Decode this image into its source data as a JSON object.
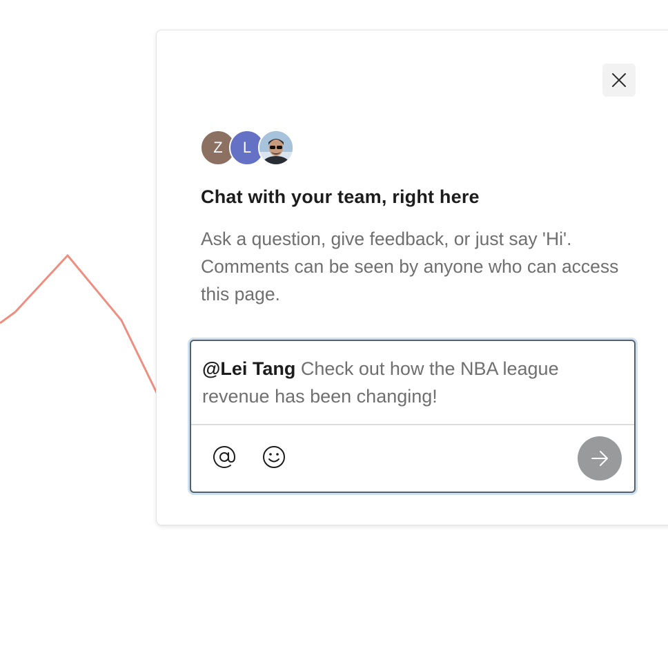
{
  "colors": {
    "chart_line": "#ee8e80",
    "title_text": "#1c1c1c",
    "body_text": "#6f6f6f",
    "send_button_bg": "#999a9b",
    "avatar_z": "#8c7163",
    "avatar_l": "#6471c4"
  },
  "dialog": {
    "close_icon": "close-icon",
    "avatars": [
      {
        "initial": "Z",
        "color": "#8c7163"
      },
      {
        "initial": "L",
        "color": "#6471c4"
      },
      {
        "initial": "",
        "type": "photo"
      }
    ],
    "title": "Chat with your team, right here",
    "description": "Ask a question, give feedback, or just say 'Hi'. Comments can be seen by anyone who can access this page."
  },
  "composer": {
    "mention": "@Lei Tang",
    "message": " Check out how the NBA league revenue has been changing!",
    "mention_icon": "at-sign-icon",
    "emoji_icon": "smiley-icon",
    "send_icon": "arrow-right-icon"
  }
}
